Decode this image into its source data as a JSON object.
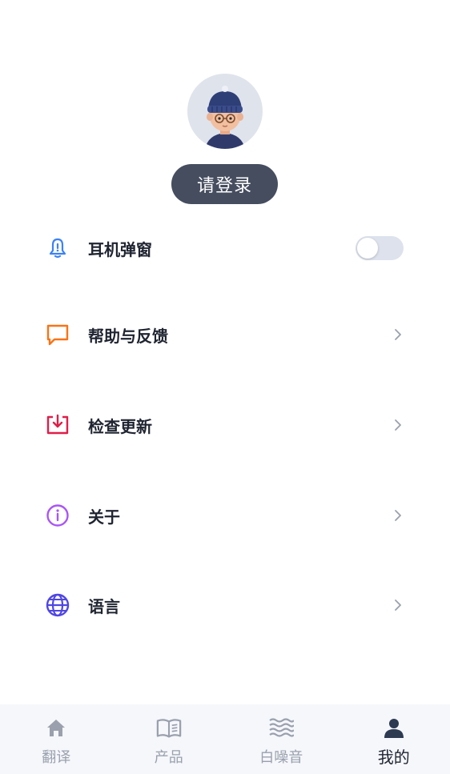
{
  "profile": {
    "login_label": "请登录"
  },
  "menu": [
    {
      "label": "耳机弹窗",
      "icon": "bell-icon",
      "color": "#3b82f6",
      "type": "toggle",
      "toggle_on": false
    },
    {
      "label": "帮助与反馈",
      "icon": "message-square-icon",
      "color": "#f97316",
      "type": "chevron"
    },
    {
      "label": "检查更新",
      "icon": "download-box-icon",
      "color": "#e11d48",
      "type": "chevron"
    },
    {
      "label": "关于",
      "icon": "info-circle-icon",
      "color": "#a855f7",
      "type": "chevron"
    },
    {
      "label": "语言",
      "icon": "globe-icon",
      "color": "#4f46e5",
      "type": "chevron"
    }
  ],
  "tabs": [
    {
      "label": "翻译",
      "icon": "home-icon",
      "active": false
    },
    {
      "label": "产品",
      "icon": "book-icon",
      "active": false
    },
    {
      "label": "白噪音",
      "icon": "waves-icon",
      "active": false
    },
    {
      "label": "我的",
      "icon": "user-icon",
      "active": true
    }
  ],
  "colors": {
    "login_button": "#454d5f",
    "toggle_off": "#dde2ed",
    "tabbar_bg": "#f5f7fb",
    "tab_inactive": "#9aa0ad",
    "tab_active": "#2d3a52"
  }
}
